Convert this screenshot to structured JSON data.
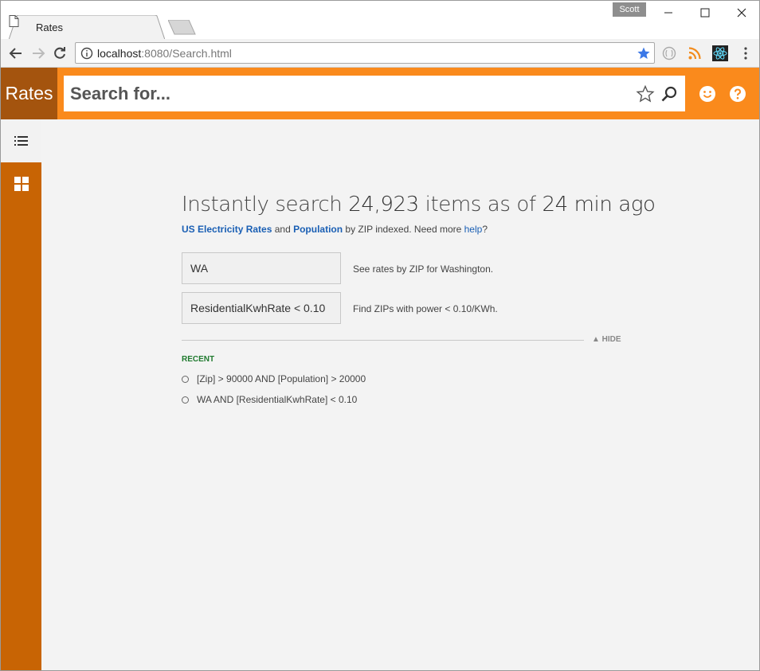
{
  "browser": {
    "tab_title": "Rates",
    "profile_name": "Scott",
    "url_host": "localhost",
    "url_rest": ":8080/Search.html",
    "bookmark_star_color": "#3b78e7"
  },
  "app": {
    "logo_text": "Rates",
    "search_placeholder": "Search for...",
    "accent_color": "#fa8a1c",
    "sidebar_color": "#c86404"
  },
  "main": {
    "headline_prefix": "Instantly search ",
    "headline_count": "24,923",
    "headline_mid": " items as of ",
    "headline_age": "24 min ago",
    "sub_link_1": "US Electricity Rates",
    "sub_and": " and ",
    "sub_link_2": "Population",
    "sub_text": " by ZIP indexed. Need more ",
    "sub_help": "help",
    "sub_q": "?",
    "examples": [
      {
        "query": "WA",
        "description": "See rates by ZIP for Washington."
      },
      {
        "query": "ResidentialKwhRate < 0.10",
        "description": "Find ZIPs with power < 0.10/KWh."
      }
    ],
    "hide_label": "▲ HIDE",
    "recent_label": "RECENT",
    "recent": [
      "[Zip] > 90000 AND [Population] > 20000",
      "WA AND [ResidentialKwhRate] < 0.10"
    ]
  }
}
